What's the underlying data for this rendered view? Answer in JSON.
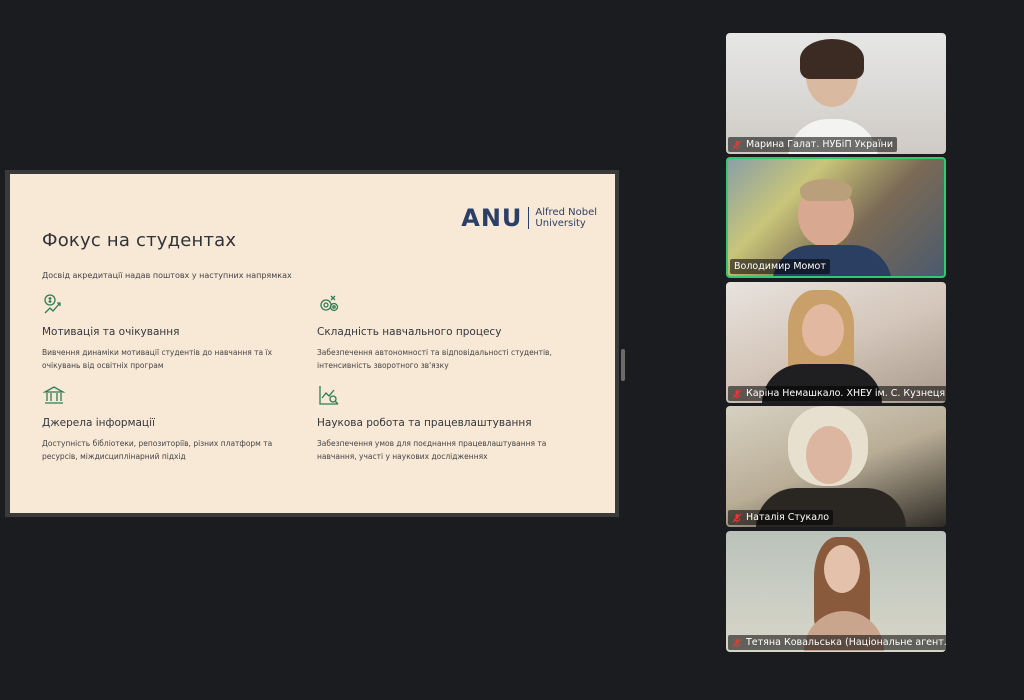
{
  "slide": {
    "logo_mark": "ANU",
    "logo_line1": "Alfred Nobel",
    "logo_line2": "University",
    "title": "Фокус на студентах",
    "subtitle": "Досвід акредитації надав поштовх у наступних напрямках",
    "blocks": [
      {
        "icon": "money-growth-icon",
        "title": "Мотивація та очікування",
        "desc": "Вивчення динаміки мотивації студентів до навчання та їх очікувань від освітніх програм"
      },
      {
        "icon": "gears-icon",
        "title": "Складність навчального процесу",
        "desc": "Забезпечення автономності та відповідальності студентів, інтенсивність зворотного зв'язку"
      },
      {
        "icon": "bank-building-icon",
        "title": "Джерела інформації",
        "desc": "Доступність бібліотеки, репозиторіїв, різних платформ та ресурсів, міждисциплінарний підхід"
      },
      {
        "icon": "chart-search-icon",
        "title": "Наукова робота та працевлаштування",
        "desc": "Забезпечення умов для поєднання працевлаштування та навчання, участі у наукових дослідженнях"
      }
    ]
  },
  "participants": [
    {
      "name": "Марина Галат. НУБіП України",
      "muted": true,
      "active": false
    },
    {
      "name": "Володимир Момот",
      "muted": false,
      "active": true
    },
    {
      "name": "Каріна Немашкало. ХНЕУ ім. С. Кузнеця",
      "muted": true,
      "active": false
    },
    {
      "name": "Наталія Стукало",
      "muted": true,
      "active": false
    },
    {
      "name": "Тетяна Ковальська (Національне агент...",
      "muted": true,
      "active": false
    }
  ],
  "colors": {
    "slide_bg": "#f8e8d6",
    "icon_green": "#2e7d57",
    "logo_blue": "#2c3f66",
    "active_border": "#2ecc71",
    "muted_red": "#e53935"
  }
}
